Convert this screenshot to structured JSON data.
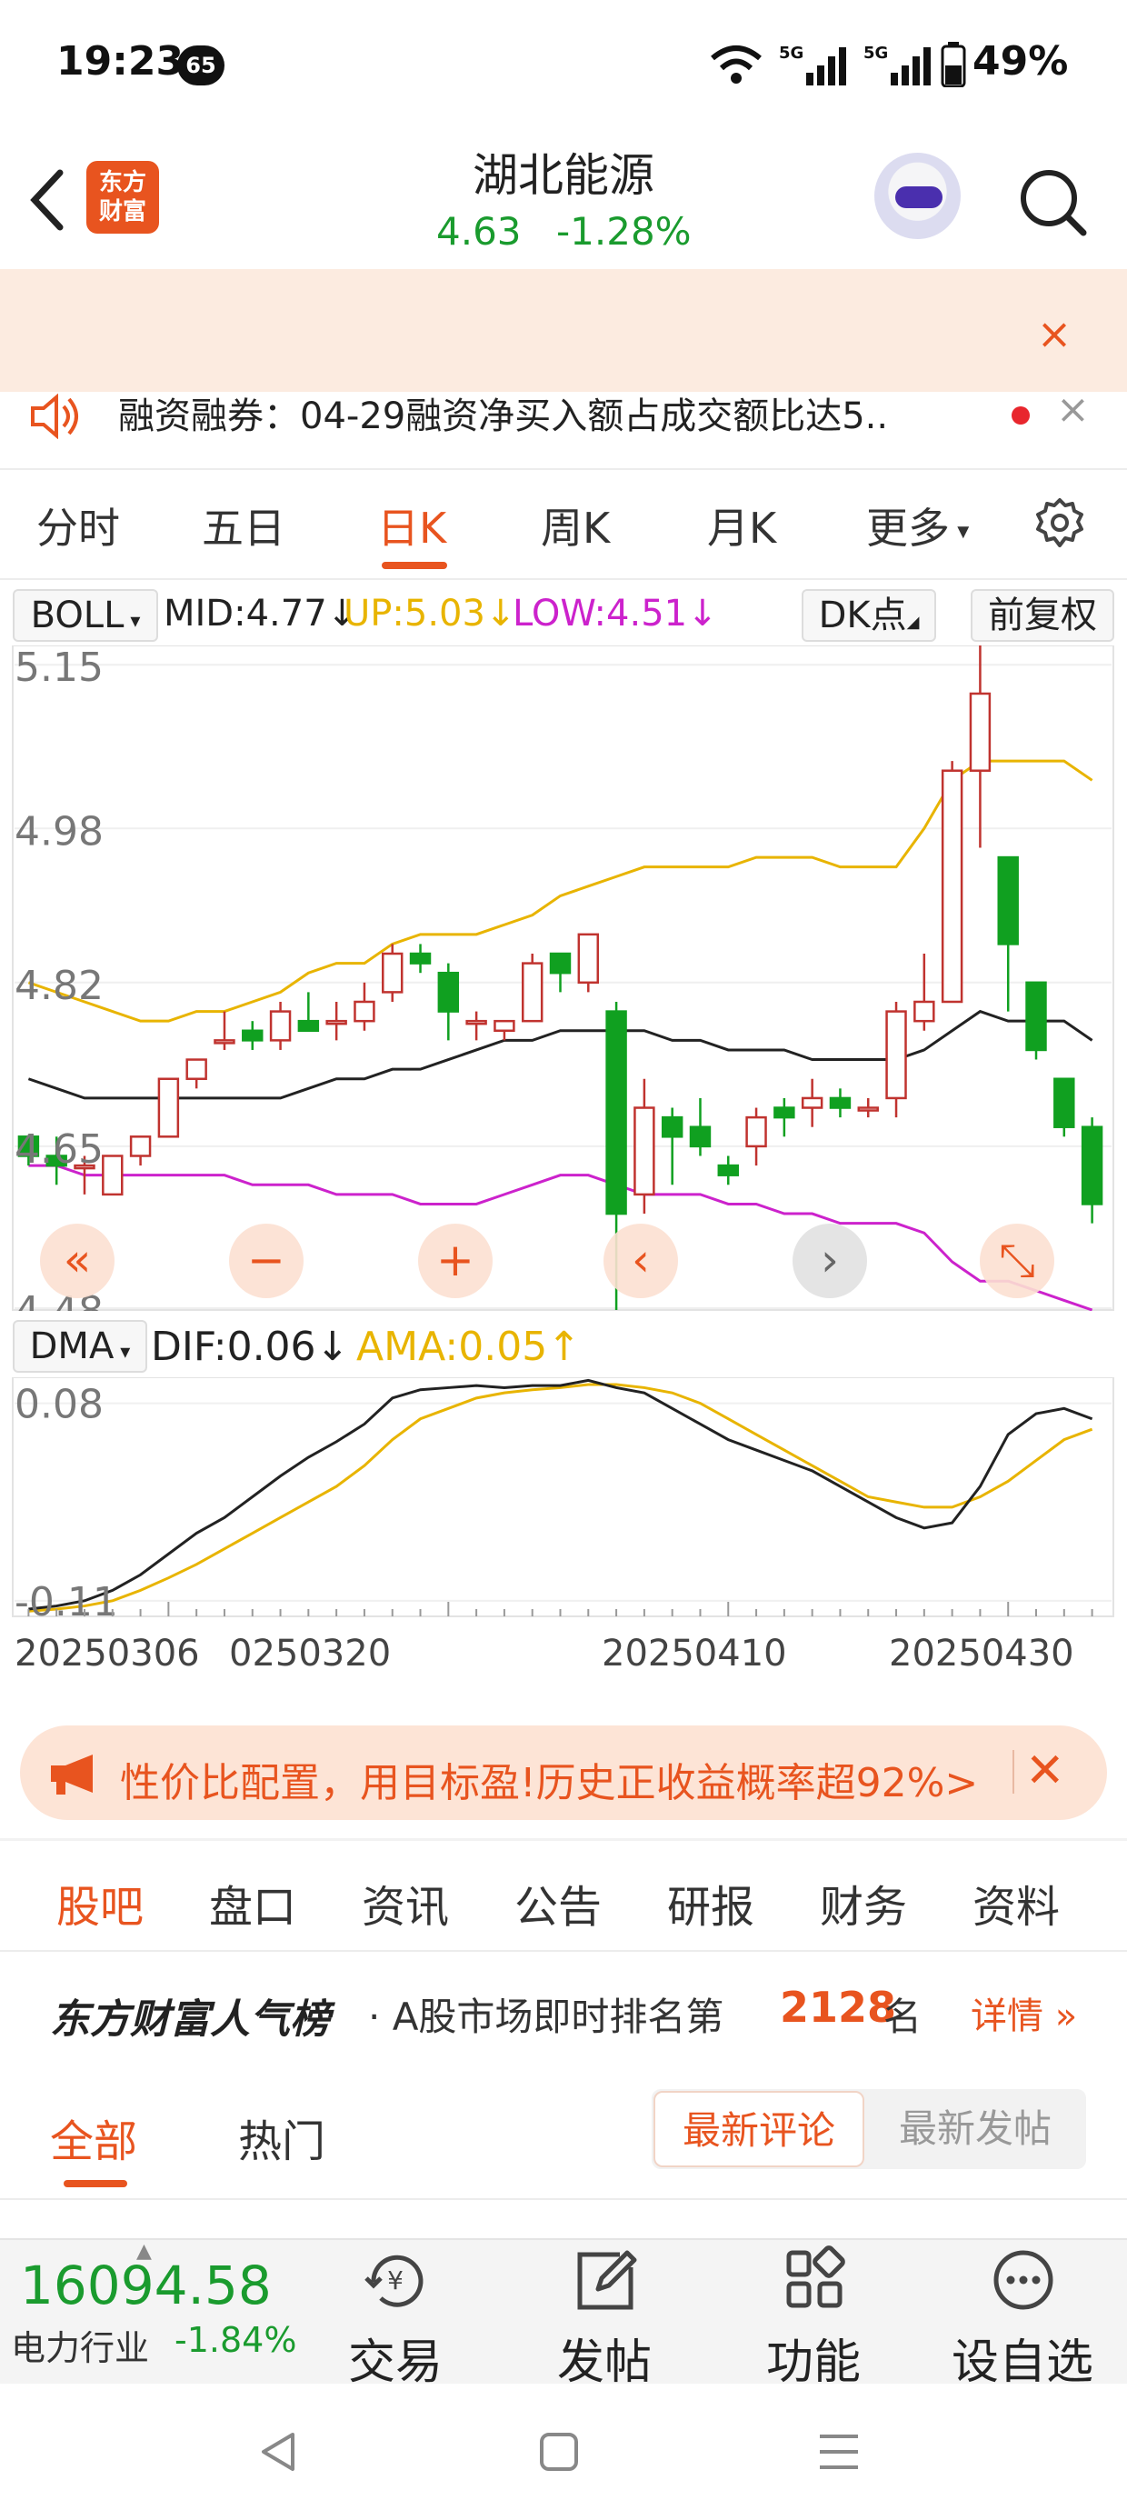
{
  "status_bar": {
    "time": "19:23",
    "notification_count": "65",
    "battery": "49%",
    "signal_label": "5G"
  },
  "header": {
    "logo_text_line1": "东方",
    "logo_text_line2": "财富",
    "stock_name": "湖北能源",
    "price": "4.63",
    "change_pct": "-1.28%"
  },
  "news": {
    "text": "融资融券：04-29融资净买入额占成交额比达5.."
  },
  "period_tabs": [
    "分时",
    "五日",
    "日K",
    "周K",
    "月K",
    "更多"
  ],
  "active_period_tab": "日K",
  "boll": {
    "selector": "BOLL",
    "mid": "MID:4.77↓",
    "up": "UP:5.03↓",
    "low": "LOW:4.51↓",
    "dk_button": "DK点",
    "adjust_button": "前复权"
  },
  "price_axis": [
    "5.15",
    "4.98",
    "4.82",
    "4.65",
    "4.48"
  ],
  "dma": {
    "selector": "DMA",
    "dif": "DIF:0.06↓",
    "ama": "AMA:0.05↑",
    "axis_top": "0.08",
    "axis_bottom": "-0.11"
  },
  "dates": [
    "20250306",
    "0250320",
    "20250410",
    "20250430"
  ],
  "chart_controls": [
    "«",
    "−",
    "+",
    "‹",
    "›",
    "⤡"
  ],
  "ad": {
    "text": "性价比配置，用目标盈!历史正收益概率超92%>"
  },
  "section_tabs": [
    "股吧",
    "盘口",
    "资讯",
    "公告",
    "研报",
    "财务",
    "资料"
  ],
  "popularity": {
    "brand": "东方财富人气榜",
    "text": "· A股市场即时排名第",
    "rank": "2128",
    "unit": "名",
    "detail": "详情 »"
  },
  "comment_tabs": {
    "all": "全部",
    "hot": "热门",
    "sort_comment": "最新评论",
    "sort_post": "最新发帖"
  },
  "bottom_bar": {
    "index_value": "16094.58",
    "industry": "电力行业",
    "industry_change": "-1.84%",
    "trade": "交易",
    "post": "发帖",
    "functions": "功能",
    "watchlist": "设自选"
  },
  "colors": {
    "accent": "#e8541f",
    "down_green": "#1a9b2e",
    "up_red": "#c0332f",
    "candle_green": "#10a020",
    "mid_line": "#222222",
    "upper_band": "#e8b400",
    "lower_band": "#cc22cc"
  },
  "chart_data": {
    "type": "candlestick",
    "price_ylim": [
      4.48,
      5.17
    ],
    "candles": [
      {
        "o": 4.66,
        "h": 4.66,
        "l": 4.63,
        "c": 4.64
      },
      {
        "o": 4.64,
        "h": 4.66,
        "l": 4.61,
        "c": 4.63
      },
      {
        "o": 4.63,
        "h": 4.64,
        "l": 4.6,
        "c": 4.63
      },
      {
        "o": 4.6,
        "h": 4.64,
        "l": 4.6,
        "c": 4.64
      },
      {
        "o": 4.64,
        "h": 4.66,
        "l": 4.63,
        "c": 4.66
      },
      {
        "o": 4.66,
        "h": 4.72,
        "l": 4.66,
        "c": 4.72
      },
      {
        "o": 4.72,
        "h": 4.74,
        "l": 4.71,
        "c": 4.74
      },
      {
        "o": 4.76,
        "h": 4.79,
        "l": 4.75,
        "c": 4.76
      },
      {
        "o": 4.77,
        "h": 4.78,
        "l": 4.75,
        "c": 4.76
      },
      {
        "o": 4.76,
        "h": 4.8,
        "l": 4.75,
        "c": 4.79
      },
      {
        "o": 4.78,
        "h": 4.81,
        "l": 4.77,
        "c": 4.77
      },
      {
        "o": 4.78,
        "h": 4.8,
        "l": 4.76,
        "c": 4.78
      },
      {
        "o": 4.78,
        "h": 4.82,
        "l": 4.77,
        "c": 4.8
      },
      {
        "o": 4.81,
        "h": 4.86,
        "l": 4.8,
        "c": 4.85
      },
      {
        "o": 4.85,
        "h": 4.86,
        "l": 4.83,
        "c": 4.84
      },
      {
        "o": 4.83,
        "h": 4.84,
        "l": 4.76,
        "c": 4.79
      },
      {
        "o": 4.78,
        "h": 4.79,
        "l": 4.76,
        "c": 4.78
      },
      {
        "o": 4.77,
        "h": 4.78,
        "l": 4.76,
        "c": 4.78
      },
      {
        "o": 4.78,
        "h": 4.85,
        "l": 4.78,
        "c": 4.84
      },
      {
        "o": 4.85,
        "h": 4.85,
        "l": 4.81,
        "c": 4.83
      },
      {
        "o": 4.82,
        "h": 4.87,
        "l": 4.81,
        "c": 4.87
      },
      {
        "o": 4.79,
        "h": 4.8,
        "l": 4.48,
        "c": 4.58
      },
      {
        "o": 4.6,
        "h": 4.72,
        "l": 4.58,
        "c": 4.69
      },
      {
        "o": 4.68,
        "h": 4.69,
        "l": 4.61,
        "c": 4.66
      },
      {
        "o": 4.67,
        "h": 4.7,
        "l": 4.64,
        "c": 4.65
      },
      {
        "o": 4.63,
        "h": 4.64,
        "l": 4.61,
        "c": 4.62
      },
      {
        "o": 4.65,
        "h": 4.69,
        "l": 4.63,
        "c": 4.68
      },
      {
        "o": 4.69,
        "h": 4.7,
        "l": 4.66,
        "c": 4.68
      },
      {
        "o": 4.69,
        "h": 4.72,
        "l": 4.67,
        "c": 4.7
      },
      {
        "o": 4.7,
        "h": 4.71,
        "l": 4.68,
        "c": 4.69
      },
      {
        "o": 4.69,
        "h": 4.7,
        "l": 4.68,
        "c": 4.69
      },
      {
        "o": 4.7,
        "h": 4.8,
        "l": 4.68,
        "c": 4.79
      },
      {
        "o": 4.78,
        "h": 4.85,
        "l": 4.77,
        "c": 4.8
      },
      {
        "o": 4.8,
        "h": 5.05,
        "l": 4.8,
        "c": 5.04
      },
      {
        "o": 5.04,
        "h": 5.17,
        "l": 4.96,
        "c": 5.12
      },
      {
        "o": 4.95,
        "h": 4.95,
        "l": 4.79,
        "c": 4.86
      },
      {
        "o": 4.82,
        "h": 4.82,
        "l": 4.74,
        "c": 4.75
      },
      {
        "o": 4.72,
        "h": 4.72,
        "l": 4.66,
        "c": 4.67
      },
      {
        "o": 4.67,
        "h": 4.68,
        "l": 4.57,
        "c": 4.59
      }
    ],
    "mid": [
      4.72,
      4.71,
      4.7,
      4.7,
      4.7,
      4.7,
      4.7,
      4.7,
      4.7,
      4.7,
      4.71,
      4.72,
      4.72,
      4.73,
      4.73,
      4.74,
      4.75,
      4.76,
      4.76,
      4.77,
      4.77,
      4.77,
      4.77,
      4.76,
      4.76,
      4.75,
      4.75,
      4.75,
      4.74,
      4.74,
      4.74,
      4.74,
      4.75,
      4.77,
      4.79,
      4.78,
      4.78,
      4.78,
      4.76
    ],
    "upper": [
      4.82,
      4.81,
      4.8,
      4.79,
      4.78,
      4.78,
      4.79,
      4.79,
      4.8,
      4.81,
      4.83,
      4.84,
      4.84,
      4.86,
      4.87,
      4.87,
      4.87,
      4.88,
      4.89,
      4.91,
      4.92,
      4.93,
      4.94,
      4.94,
      4.94,
      4.94,
      4.95,
      4.95,
      4.95,
      4.94,
      4.94,
      4.94,
      4.98,
      5.03,
      5.05,
      5.05,
      5.05,
      5.05,
      5.03
    ],
    "lower": [
      4.63,
      4.63,
      4.62,
      4.62,
      4.62,
      4.62,
      4.62,
      4.62,
      4.61,
      4.61,
      4.61,
      4.6,
      4.6,
      4.6,
      4.59,
      4.59,
      4.59,
      4.6,
      4.61,
      4.62,
      4.62,
      4.61,
      4.6,
      4.6,
      4.6,
      4.59,
      4.59,
      4.58,
      4.58,
      4.57,
      4.57,
      4.57,
      4.56,
      4.53,
      4.51,
      4.51,
      4.5,
      4.49,
      4.48
    ],
    "dma_ylim": [
      -0.125,
      0.105
    ],
    "dif": [
      -0.118,
      -0.115,
      -0.11,
      -0.1,
      -0.085,
      -0.065,
      -0.045,
      -0.03,
      -0.01,
      0.01,
      0.028,
      0.043,
      0.06,
      0.085,
      0.093,
      0.095,
      0.097,
      0.095,
      0.097,
      0.097,
      0.102,
      0.095,
      0.09,
      0.075,
      0.06,
      0.045,
      0.035,
      0.025,
      0.015,
      0.0,
      -0.015,
      -0.03,
      -0.04,
      -0.035,
      0.0,
      0.05,
      0.07,
      0.075,
      0.065
    ],
    "ama": [
      -0.12,
      -0.118,
      -0.115,
      -0.11,
      -0.1,
      -0.088,
      -0.075,
      -0.06,
      -0.045,
      -0.03,
      -0.015,
      0.0,
      0.02,
      0.045,
      0.065,
      0.075,
      0.085,
      0.09,
      0.093,
      0.095,
      0.098,
      0.098,
      0.095,
      0.09,
      0.08,
      0.065,
      0.05,
      0.035,
      0.02,
      0.005,
      -0.01,
      -0.015,
      -0.02,
      -0.02,
      -0.01,
      0.005,
      0.025,
      0.045,
      0.055
    ]
  }
}
